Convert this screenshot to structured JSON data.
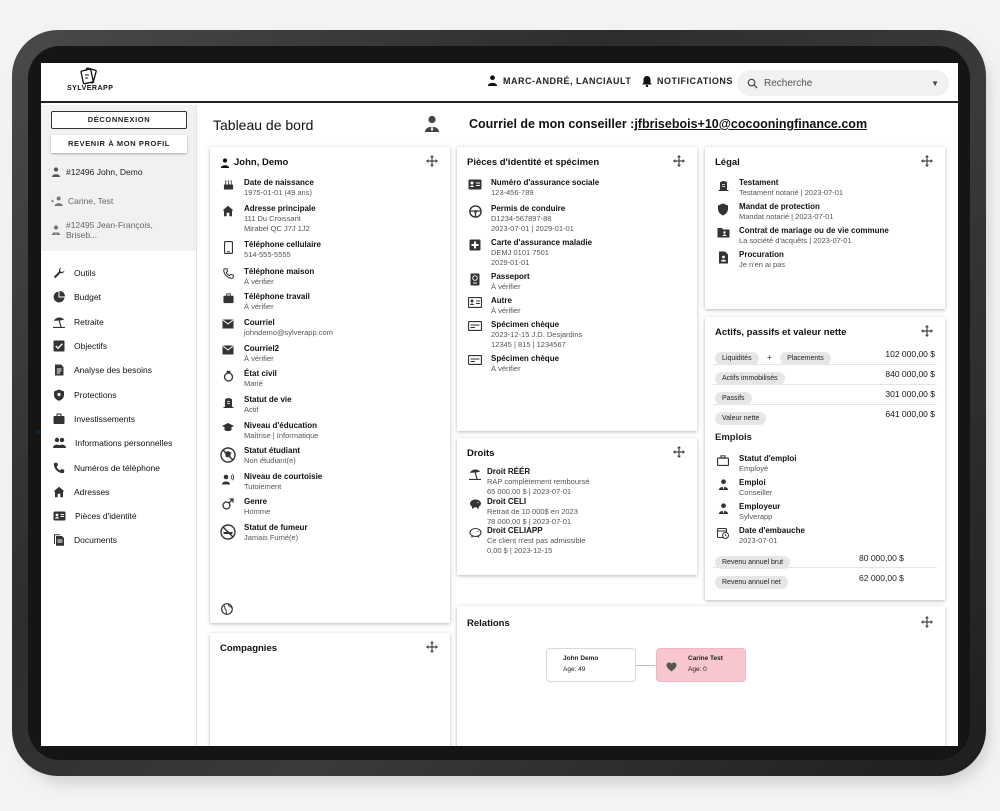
{
  "app": {
    "logo_text": "SYLVERAPP"
  },
  "header": {
    "user_name": "MARC-ANDRÉ, LANCIAULT",
    "notifications_label": "NOTIFICATIONS",
    "search_placeholder": "Recherche"
  },
  "sidebar": {
    "logout_label": "DÉCONNEXION",
    "profile_label": "REVENIR À MON PROFIL",
    "clients": [
      {
        "label": "#12496 John, Demo"
      },
      {
        "label": "Carine, Test"
      },
      {
        "label": "#12495 Jean-François, Briseb..."
      }
    ],
    "nav": [
      {
        "label": "Outils",
        "icon": "wrench-icon"
      },
      {
        "label": "Budget",
        "icon": "pie-chart-icon"
      },
      {
        "label": "Retraite",
        "icon": "beach-umbrella-icon"
      },
      {
        "label": "Objectifs",
        "icon": "checkbox-icon"
      },
      {
        "label": "Analyse des besoins",
        "icon": "document-icon"
      },
      {
        "label": "Protections",
        "icon": "shield-icon"
      },
      {
        "label": "Investissements",
        "icon": "briefcase-icon"
      },
      {
        "label": "Informations personnelles",
        "icon": "people-icon"
      },
      {
        "label": "Numéros de téléphone",
        "icon": "phone-icon"
      },
      {
        "label": "Adresses",
        "icon": "home-icon"
      },
      {
        "label": "Pièces d'identité",
        "icon": "id-card-icon"
      },
      {
        "label": "Documents",
        "icon": "documents-icon"
      }
    ]
  },
  "main": {
    "page_title": "Tableau de bord",
    "advisor_label": "Courriel de mon conseiller :",
    "advisor_email": "jfbrisebois+10@cocooningfinance.com"
  },
  "profile_card": {
    "title": "John, Demo",
    "fields": [
      {
        "title": "Date de naissance",
        "lines": [
          "1975-01-01 (49 ans)"
        ]
      },
      {
        "title": "Adresse principale",
        "lines": [
          "111 Du Croissant",
          "Mirabel QC J7J 1J2"
        ]
      },
      {
        "title": "Téléphone cellulaire",
        "lines": [
          "514-555-5555"
        ]
      },
      {
        "title": "Téléphone maison",
        "lines": [
          "À vérifier"
        ]
      },
      {
        "title": "Téléphone travail",
        "lines": [
          "À vérifier"
        ]
      },
      {
        "title": "Courriel",
        "lines": [
          "johndemo@sylverapp.com"
        ]
      },
      {
        "title": "Courriel2",
        "lines": [
          "À vérifier"
        ]
      },
      {
        "title": "État civil",
        "lines": [
          "Marié"
        ]
      },
      {
        "title": "Statut de vie",
        "lines": [
          "Actif"
        ]
      },
      {
        "title": "Niveau d'éducation",
        "lines": [
          "Maîtrise | Informatique"
        ]
      },
      {
        "title": "Statut étudiant",
        "lines": [
          "Non étudiant(e)"
        ]
      },
      {
        "title": "Niveau de courtoisie",
        "lines": [
          "Tutoiement"
        ]
      },
      {
        "title": "Genre",
        "lines": [
          "Homme"
        ]
      },
      {
        "title": "Statut de fumeur",
        "lines": [
          "Jamais Fumé(e)"
        ]
      }
    ]
  },
  "companies_card": {
    "title": "Compagnies"
  },
  "identity_card": {
    "title": "Pièces d'identité et spécimen",
    "fields": [
      {
        "title": "Numéro d'assurance sociale",
        "lines": [
          "123-456-789"
        ]
      },
      {
        "title": "Permis de conduire",
        "lines": [
          "D1234-567897-88",
          "2023-07-01 | 2029-01-01"
        ]
      },
      {
        "title": "Carte d'assurance maladie",
        "lines": [
          "DEMJ 0101 7501",
          "2029-01-01"
        ]
      },
      {
        "title": "Passeport",
        "lines": [
          "À vérifier"
        ]
      },
      {
        "title": "Autre",
        "lines": [
          "À vérifier"
        ]
      },
      {
        "title": "Spécimen chèque",
        "lines": [
          "2023-12-15 J.D. Desjardins",
          "12345 | 815 | 1234567"
        ]
      },
      {
        "title": "Spécimen chèque",
        "lines": [
          "À vérifier"
        ]
      }
    ]
  },
  "rights_card": {
    "title": "Droits",
    "fields": [
      {
        "title": "Droit RÉÉR",
        "lines": [
          "RAP complètement remboursé",
          "65 000,00 $ | 2023-07-01"
        ]
      },
      {
        "title": "Droit CELI",
        "lines": [
          "Retrait de 10 000$ en 2023",
          "78 000,00 $ | 2023-07-01"
        ]
      },
      {
        "title": "Droit CELIAPP",
        "lines": [
          "Ce client n'est pas admissible",
          "0,00 $ | 2023-12-15"
        ]
      }
    ]
  },
  "legal_card": {
    "title": "Légal",
    "fields": [
      {
        "title": "Testament",
        "lines": [
          "Testament notarié | 2023-07-01"
        ]
      },
      {
        "title": "Mandat de protection",
        "lines": [
          "Mandat notarié | 2023-07-01"
        ]
      },
      {
        "title": "Contrat de mariage ou de vie commune",
        "lines": [
          "La société d'acquêts | 2023-07-01"
        ]
      },
      {
        "title": "Procuration",
        "lines": [
          "Je n'en ai pas"
        ]
      }
    ]
  },
  "assets_card": {
    "title": "Actifs, passifs et valeur nette",
    "rows": [
      {
        "chips": [
          "Liquidités",
          "Placements"
        ],
        "joiner": "+",
        "amount": "102 000,00 $"
      },
      {
        "chips": [
          "Actifs immobilisés"
        ],
        "amount": "840 000,00 $"
      },
      {
        "chips": [
          "Passifs"
        ],
        "amount": "301 000,00 $"
      },
      {
        "chips": [
          "Valeur nette"
        ],
        "amount": "641 000,00 $"
      }
    ],
    "jobs_title": "Emplois",
    "jobs": [
      {
        "title": "Statut d'emploi",
        "lines": [
          "Employé"
        ]
      },
      {
        "title": "Emploi",
        "lines": [
          "Conseiller"
        ]
      },
      {
        "title": "Employeur",
        "lines": [
          "Sylverapp"
        ]
      },
      {
        "title": "Date d'embauche",
        "lines": [
          "2023-07-01"
        ]
      }
    ],
    "income": [
      {
        "chip": "Revenu annuel brut",
        "amount": "80 000,00 $"
      },
      {
        "chip": "Revenu annuel net",
        "amount": "62 000,00 $"
      }
    ]
  },
  "relations_card": {
    "title": "Relations",
    "nodes": [
      {
        "name": "John Demo",
        "age": "Age: 49"
      },
      {
        "name": "Carine Test",
        "age": "Age: 0"
      }
    ]
  }
}
